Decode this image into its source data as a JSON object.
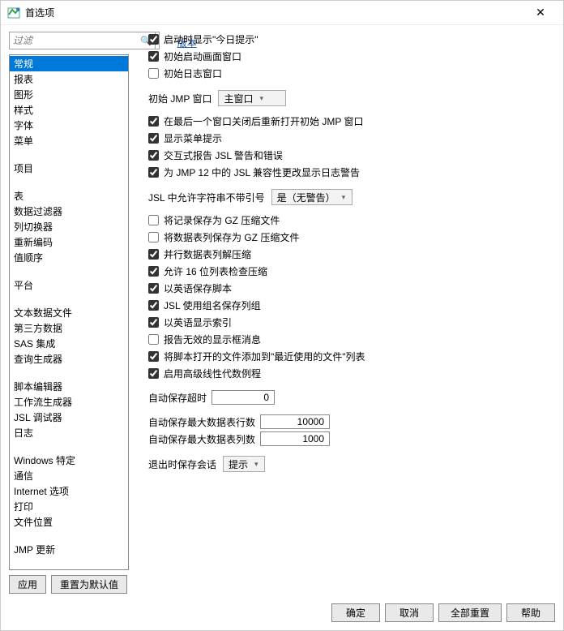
{
  "titlebar": {
    "title": "首选项"
  },
  "search": {
    "placeholder": "过滤"
  },
  "version_link": "版本",
  "categories": {
    "groups": [
      [
        "常规",
        "报表",
        "图形",
        "样式",
        "字体",
        "菜单"
      ],
      [
        "项目"
      ],
      [
        "表",
        "数据过滤器",
        "列切换器",
        "重新编码",
        "值顺序"
      ],
      [
        "平台"
      ],
      [
        "文本数据文件",
        "第三方数据",
        "SAS 集成",
        "查询生成器"
      ],
      [
        "脚本编辑器",
        "工作流生成器",
        "JSL 调试器",
        "日志"
      ],
      [
        "Windows 特定",
        "通信",
        "Internet 选项",
        "打印",
        "文件位置"
      ],
      [
        "JMP 更新"
      ]
    ],
    "selected": "常规"
  },
  "left_buttons": {
    "apply": "应用",
    "reset_defaults": "重置为默认值"
  },
  "settings": {
    "cb1": {
      "checked": true,
      "label": "启动时显示\"今日提示\""
    },
    "cb2": {
      "checked": true,
      "label": "初始启动画面窗口"
    },
    "cb3": {
      "checked": false,
      "label": "初始日志窗口"
    },
    "initial_window": {
      "label": "初始 JMP 窗口",
      "value": "主窗口"
    },
    "cb4": {
      "checked": true,
      "label": "在最后一个窗口关闭后重新打开初始 JMP 窗口"
    },
    "cb5": {
      "checked": true,
      "label": "显示菜单提示"
    },
    "cb6": {
      "checked": true,
      "label": "交互式报告 JSL 警告和错误"
    },
    "cb7": {
      "checked": true,
      "label": "为 JMP 12 中的 JSL 兼容性更改显示日志警告"
    },
    "jsl_quotes": {
      "label": "JSL 中允许字符串不带引号",
      "value": "是（无警告）"
    },
    "cb8": {
      "checked": false,
      "label": "将记录保存为 GZ 压缩文件"
    },
    "cb9": {
      "checked": false,
      "label": "将数据表列保存为 GZ 压缩文件"
    },
    "cb10": {
      "checked": true,
      "label": "并行数据表列解压缩"
    },
    "cb11": {
      "checked": true,
      "label": "允许 16 位列表检查压缩"
    },
    "cb12": {
      "checked": true,
      "label": "以英语保存脚本"
    },
    "cb13": {
      "checked": true,
      "label": "JSL 使用组名保存列组"
    },
    "cb14": {
      "checked": true,
      "label": "以英语显示索引"
    },
    "cb15": {
      "checked": false,
      "label": "报告无效的显示框消息"
    },
    "cb16": {
      "checked": true,
      "label": "将脚本打开的文件添加到\"最近使用的文件\"列表"
    },
    "cb17": {
      "checked": true,
      "label": "启用高级线性代数例程"
    },
    "autosave_timeout": {
      "label": "自动保存超时",
      "value": "0"
    },
    "autosave_maxrows": {
      "label": "自动保存最大数据表行数",
      "value": "10000"
    },
    "autosave_maxcols": {
      "label": "自动保存最大数据表列数",
      "value": "1000"
    },
    "exit_session": {
      "label": "退出时保存会话",
      "value": "提示"
    }
  },
  "footer": {
    "ok": "确定",
    "cancel": "取消",
    "reset_all": "全部重置",
    "help": "帮助"
  }
}
